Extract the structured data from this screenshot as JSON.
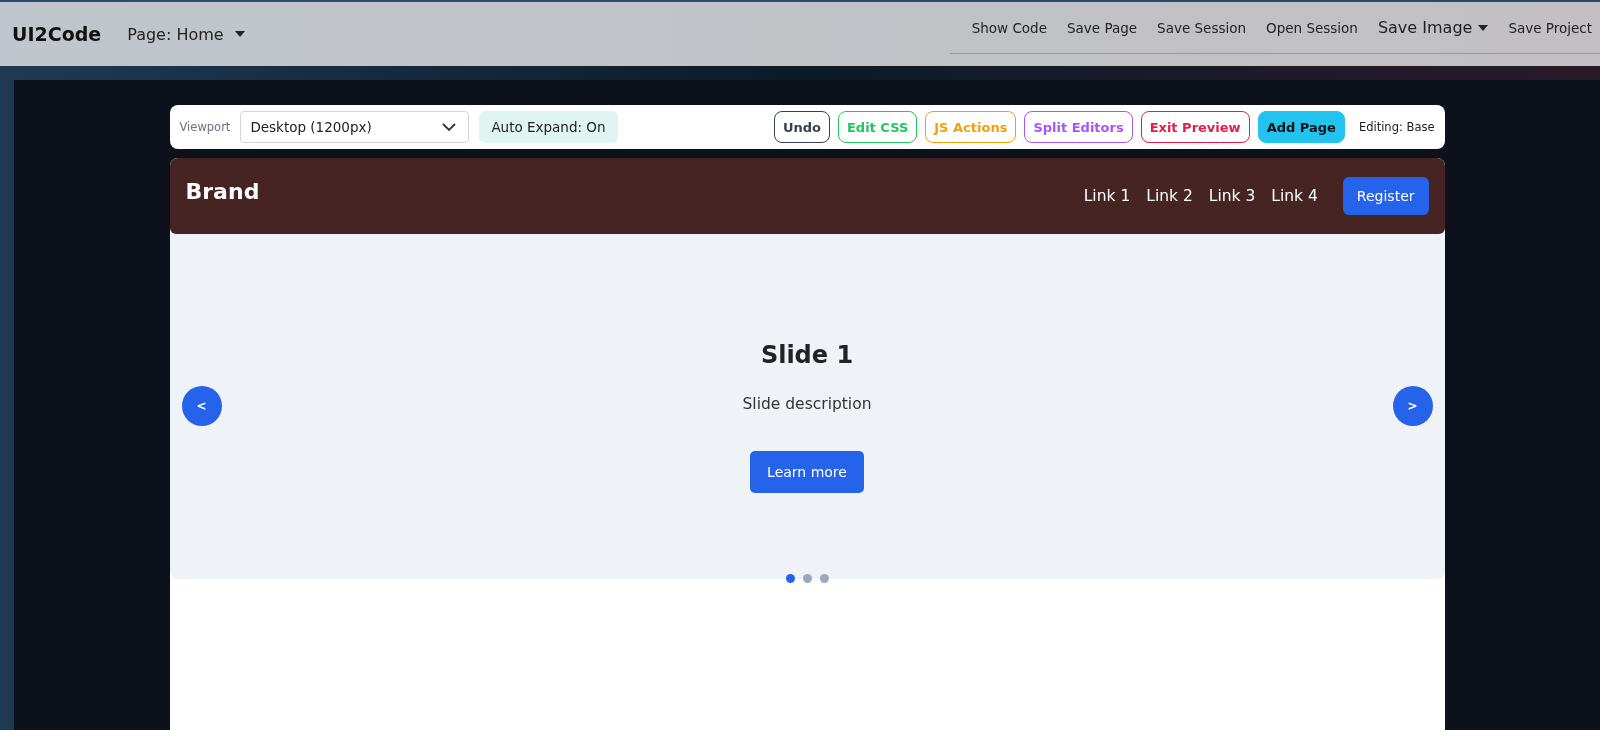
{
  "app_bar": {
    "title": "UI2Code",
    "page_menu": "Page: Home",
    "actions": [
      {
        "label": "Show Code",
        "dropdown": false
      },
      {
        "label": "Save Page",
        "dropdown": false
      },
      {
        "label": "Save Session",
        "dropdown": false
      },
      {
        "label": "Open Session",
        "dropdown": false
      },
      {
        "label": "Save Image",
        "dropdown": true
      },
      {
        "label": "Save Project",
        "dropdown": false
      }
    ]
  },
  "toolbar": {
    "viewport_label": "Viewport",
    "viewport_value": "Desktop (1200px)",
    "auto_expand": "Auto Expand: On",
    "buttons": [
      {
        "label": "Undo",
        "kind": "outline",
        "color": "#374151"
      },
      {
        "label": "Edit CSS",
        "kind": "outline",
        "color": "#22c55e"
      },
      {
        "label": "JS Actions",
        "kind": "outline",
        "color": "#f59e0b"
      },
      {
        "label": "Split Editors",
        "kind": "outline",
        "color": "#a855f7"
      },
      {
        "label": "Exit Preview",
        "kind": "outline",
        "color": "#e11d48"
      },
      {
        "label": "Add Page",
        "kind": "filled",
        "color": "#22c3ee"
      }
    ],
    "editing": "Editing: Base"
  },
  "preview": {
    "navbar": {
      "brand": "Brand",
      "links": [
        "Link 1",
        "Link 2",
        "Link 3",
        "Link 4"
      ],
      "cta": "Register"
    },
    "carousel": {
      "prev": "<",
      "next": ">",
      "title": "Slide 1",
      "description": "Slide description",
      "button": "Learn more",
      "dots": [
        {
          "selected": true
        },
        {
          "selected": false
        },
        {
          "selected": false
        }
      ]
    }
  }
}
